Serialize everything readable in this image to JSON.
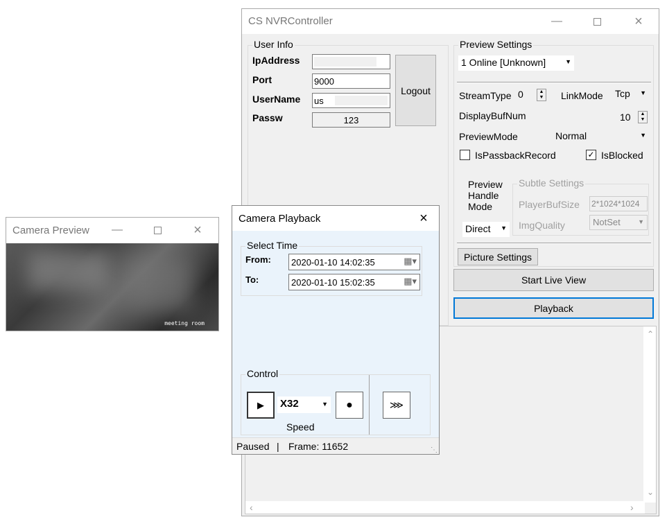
{
  "main_window": {
    "title": "CS NVRController",
    "user_info": {
      "group_title": "User Info",
      "ip_label": "IpAddress",
      "ip_value": "",
      "port_label": "Port",
      "port_value": "9000",
      "username_label": "UserName",
      "username_value": "us",
      "password_label": "Passw",
      "password_value": "123",
      "logout_label": "Logout"
    },
    "preview_settings": {
      "group_title": "Preview Settings",
      "channel_value": "1 Online [Unknown]",
      "stream_type_label": "StreamType",
      "stream_type_value": "0",
      "link_mode_label": "LinkMode",
      "link_mode_value": "Tcp",
      "display_buf_label": "DisplayBufNum",
      "display_buf_value": "10",
      "preview_mode_label": "PreviewMode",
      "preview_mode_value": "Normal",
      "passback_label": "IsPassbackRecord",
      "passback_checked": false,
      "blocked_label": "IsBlocked",
      "blocked_checked": true,
      "handle_mode_label_1": "Preview",
      "handle_mode_label_2": "Handle",
      "handle_mode_label_3": "Mode",
      "handle_mode_value": "Direct",
      "subtle_title": "Subtle Settings",
      "player_buf_label": "PlayerBufSize",
      "player_buf_value": "2*1024*1024",
      "img_quality_label": "ImgQuality",
      "img_quality_value": "NotSet",
      "picture_settings_label": "Picture Settings"
    },
    "start_live_view_label": "Start Live View",
    "playback_label": "Playback"
  },
  "camera_preview": {
    "title": "Camera Preview",
    "overlay_text": "meeting room"
  },
  "playback_dialog": {
    "title": "Camera Playback",
    "select_time_title": "Select Time",
    "from_label": "From:",
    "from_value": "2020-01-10 14:02:35",
    "to_label": "To:",
    "to_value": "2020-01-10 15:02:35",
    "control_title": "Control",
    "speed_value": "X32",
    "speed_label": "Speed",
    "status_state": "Paused",
    "status_separator": "|",
    "status_frame": "Frame: 11652"
  },
  "colors": {
    "accent": "#0078d7",
    "window_bg": "#f0f0f0",
    "dialog_bg": "#eaf3fb"
  }
}
